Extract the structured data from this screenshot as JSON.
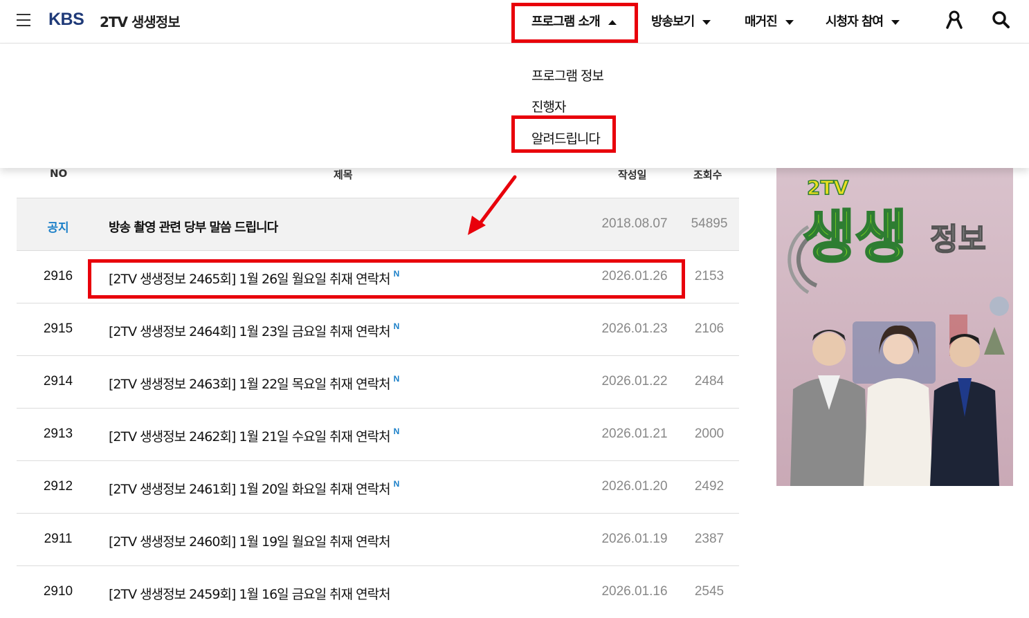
{
  "header": {
    "logo": "KBS",
    "site_title": "2TV 생생정보",
    "nav": [
      {
        "label": "프로그램 소개",
        "open": true
      },
      {
        "label": "방송보기",
        "open": false
      },
      {
        "label": "매거진",
        "open": false
      },
      {
        "label": "시청자 참여",
        "open": false
      }
    ],
    "icons": [
      "menu-icon",
      "user-icon",
      "search-icon"
    ]
  },
  "dropdown": {
    "items": [
      "프로그램 정보",
      "진행자",
      "알려드립니다"
    ]
  },
  "table": {
    "headers": [
      "NO",
      "제목",
      "작성일",
      "조회수"
    ],
    "rows": [
      {
        "no": "공지",
        "title": "방송 촬영 관련 당부 말씀 드립니다",
        "new": "",
        "date": "2018.08.07",
        "views": "54895"
      },
      {
        "no": "2916",
        "title": "[2TV 생생정보 2465회] 1월 26일 월요일 취재 연락처",
        "new": "N",
        "date": "2026.01.26",
        "views": "2153"
      },
      {
        "no": "2915",
        "title": "[2TV 생생정보 2464회] 1월 23일 금요일 취재 연락처",
        "new": "N",
        "date": "2026.01.23",
        "views": "2106"
      },
      {
        "no": "2914",
        "title": "[2TV 생생정보 2463회] 1월 22일 목요일 취재 연락처",
        "new": "N",
        "date": "2026.01.22",
        "views": "2484"
      },
      {
        "no": "2913",
        "title": "[2TV 생생정보 2462회] 1월 21일 수요일 취재 연락처",
        "new": "N",
        "date": "2026.01.21",
        "views": "2000"
      },
      {
        "no": "2912",
        "title": "[2TV 생생정보 2461회] 1월 20일 화요일 취재 연락처",
        "new": "N",
        "date": "2026.01.20",
        "views": "2492"
      },
      {
        "no": "2911",
        "title": "[2TV 생생정보 2460회] 1월 19일 월요일 취재 연락처",
        "new": "",
        "date": "2026.01.19",
        "views": "2387"
      },
      {
        "no": "2910",
        "title": "[2TV 생생정보 2459회] 1월 16일 금요일 취재 연락처",
        "new": "",
        "date": "2026.01.16",
        "views": "2545"
      }
    ]
  },
  "banner": {
    "logo_small": "2TV",
    "logo_main": "생생",
    "logo_sub": "정보"
  },
  "colors": {
    "accent_blue": "#1a7fc8",
    "brand_navy": "#1f3a78",
    "highlight_red": "#e8000b"
  }
}
